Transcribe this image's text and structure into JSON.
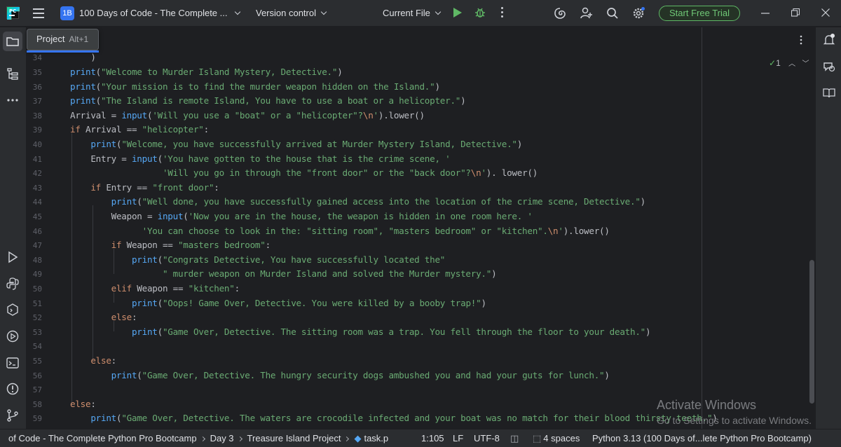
{
  "titlebar": {
    "logo_text": "PC",
    "project_badge": "1B",
    "project_name": "100 Days of Code - The Complete ...",
    "vcs_label": "Version control",
    "run_config": "Current File",
    "trial_button": "Start Free Trial"
  },
  "tool_window": {
    "name": "Project",
    "shortcut": "Alt+1"
  },
  "editor": {
    "inspection_count": "1",
    "lines": [
      {
        "num": "34",
        "html": "    )"
      },
      {
        "num": "35",
        "html": "<span class=\"fn\">print</span>(<span class=\"str\">\"Welcome to Murder Island Mystery, Detective.\"</span>)"
      },
      {
        "num": "36",
        "html": "<span class=\"fn\">print</span>(<span class=\"str\">\"Your mission is to find the murder weapon hidden on the Island.\"</span>)"
      },
      {
        "num": "37",
        "html": "<span class=\"fn\">print</span>(<span class=\"str\">\"The Island is remote Island, You have to use a boat or a helicopter.\"</span>)"
      },
      {
        "num": "38",
        "html": "Arrival = <span class=\"fn\">input</span>(<span class=\"str\">'Will you use a \"boat\" or a \"helicopter\"?<span class=\"esc\">\\n</span>'</span>).lower()"
      },
      {
        "num": "39",
        "html": "<span class=\"kw\">if</span> Arrival == <span class=\"str\">\"helicopter\"</span>:"
      },
      {
        "num": "40",
        "html": "    <span class=\"fn\">print</span>(<span class=\"str\">\"Welcome, you have successfully arrived at Murder Mystery Island, Detective.\"</span>)"
      },
      {
        "num": "41",
        "html": "    Entry = <span class=\"fn\">input</span>(<span class=\"str\">'You have gotten to the house that is the crime scene, '</span>"
      },
      {
        "num": "42",
        "html": "                  <span class=\"str\">'Will you go in through the \"front door\" or the \"back door\"?<span class=\"esc\">\\n</span>'</span>). lower()"
      },
      {
        "num": "43",
        "html": "    <span class=\"kw\">if</span> Entry == <span class=\"str\">\"front door\"</span>:"
      },
      {
        "num": "44",
        "html": "        <span class=\"fn\">print</span>(<span class=\"str\">\"Well done, you have successfully gained access into the location of the crime scene, Detective.\"</span>)"
      },
      {
        "num": "45",
        "html": "        Weapon = <span class=\"fn\">input</span>(<span class=\"str\">'Now you are in the house, the weapon is hidden in one room here. '</span>"
      },
      {
        "num": "46",
        "html": "              <span class=\"str\">'You can choose to look in the: \"sitting room\", \"masters bedroom\" or \"kitchen\".<span class=\"esc\">\\n</span>'</span>).lower()"
      },
      {
        "num": "47",
        "html": "        <span class=\"kw\">if</span> Weapon == <span class=\"str\">\"masters bedroom\"</span>:"
      },
      {
        "num": "48",
        "html": "            <span class=\"fn\">print</span>(<span class=\"str\">\"Congrats Detective, You have successfully located the\"</span>"
      },
      {
        "num": "49",
        "html": "                  <span class=\"str\">\" murder weapon on Murder Island and solved the Murder mystery.\"</span>)"
      },
      {
        "num": "50",
        "html": "        <span class=\"kw\">elif</span> Weapon == <span class=\"str\">\"kitchen\"</span>:"
      },
      {
        "num": "51",
        "html": "            <span class=\"fn\">print</span>(<span class=\"str\">\"Oops! Game Over, Detective. You were killed by a booby trap!\"</span>)"
      },
      {
        "num": "52",
        "html": "        <span class=\"kw\">else</span>:"
      },
      {
        "num": "53",
        "html": "            <span class=\"fn\">print</span>(<span class=\"str\">\"Game Over, Detective. The sitting room was a trap. You fell through the floor to your death.\"</span>)"
      },
      {
        "num": "54",
        "html": ""
      },
      {
        "num": "55",
        "html": "    <span class=\"kw\">else</span>:"
      },
      {
        "num": "56",
        "html": "        <span class=\"fn\">print</span>(<span class=\"str\">\"Game Over, Detective. The hungry security dogs ambushed you and had your guts for lunch.\"</span>)"
      },
      {
        "num": "57",
        "html": ""
      },
      {
        "num": "58",
        "html": "<span class=\"kw\">else</span>:"
      },
      {
        "num": "59",
        "html": "    <span class=\"fn\">print</span>(<span class=\"str\">\"Game Over, Detective. The waters are crocodile infected and your boat was no match for their blood thirsty teeth.\"</span>)"
      }
    ]
  },
  "watermark": {
    "title": "Activate Windows",
    "subtitle": "Go to Settings to activate Windows."
  },
  "statusbar": {
    "crumb1": "of Code - The Complete Python Pro Bootcamp",
    "crumb2": "Day 3",
    "crumb3": "Treasure Island Project",
    "crumb4": "task.p",
    "position": "1:105",
    "line_sep": "LF",
    "encoding": "UTF-8",
    "indent": "4 spaces",
    "interpreter": "Python 3.13 (100 Days of...lete Python Pro Bootcamp)"
  },
  "colors": {
    "keyword": "#cf8e6d",
    "function": "#56a8f5",
    "string": "#6aab73",
    "accent": "#3574f0",
    "trial": "#5fb865"
  }
}
